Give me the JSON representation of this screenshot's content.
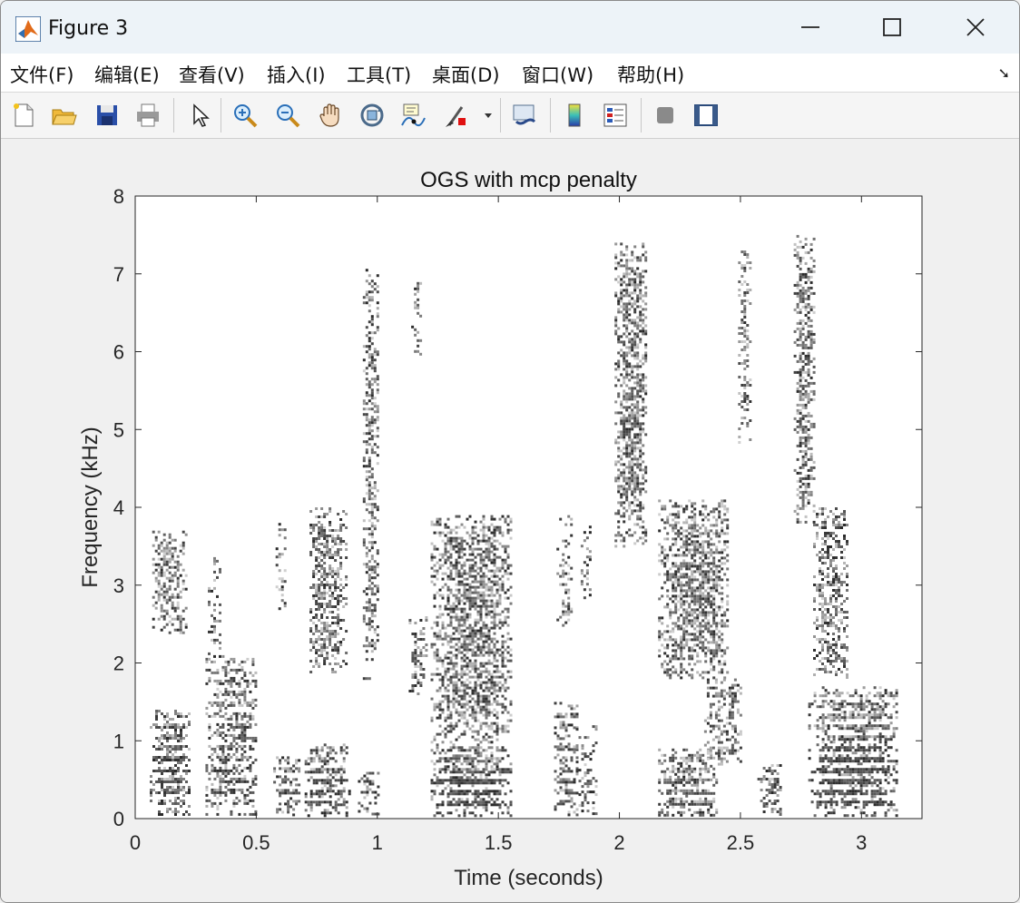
{
  "window": {
    "title": "Figure 3"
  },
  "menu": [
    "文件(F)",
    "编辑(E)",
    "查看(V)",
    "插入(I)",
    "工具(T)",
    "桌面(D)",
    "窗口(W)",
    "帮助(H)"
  ],
  "toolbar": [
    "new-figure-icon",
    "open-file-icon",
    "save-icon",
    "print-icon",
    "pointer-icon",
    "zoom-in-icon",
    "zoom-out-icon",
    "pan-icon",
    "rotate-3d-icon",
    "data-cursor-icon",
    "brush-icon",
    "link-plot-icon",
    "colorbar-icon",
    "legend-icon",
    "hide-plot-tools-icon",
    "show-plot-tools-icon"
  ],
  "chart_data": {
    "type": "heatmap",
    "title": "OGS with mcp penalty",
    "xlabel": "Time (seconds)",
    "ylabel": "Frequency (kHz)",
    "xlim": [
      0,
      3.25
    ],
    "ylim": [
      0,
      8
    ],
    "xticks": [
      "0",
      "0.5",
      "1",
      "1.5",
      "2",
      "2.5",
      "3"
    ],
    "yticks": [
      "0",
      "1",
      "2",
      "3",
      "4",
      "5",
      "6",
      "7",
      "8"
    ],
    "colormap": "gray-inverted",
    "grid": false,
    "blobs": [
      {
        "t": [
          0.06,
          0.22
        ],
        "f": [
          0.05,
          1.4
        ],
        "d": 0.85,
        "harmonics": true
      },
      {
        "t": [
          0.07,
          0.21
        ],
        "f": [
          2.4,
          3.7
        ],
        "d": 0.5
      },
      {
        "t": [
          0.29,
          0.5
        ],
        "f": [
          0.05,
          2.1
        ],
        "d": 0.75,
        "harmonics": true
      },
      {
        "t": [
          0.3,
          0.35
        ],
        "f": [
          2.0,
          3.5
        ],
        "d": 0.35
      },
      {
        "t": [
          0.57,
          0.68
        ],
        "f": [
          0.05,
          0.8
        ],
        "d": 0.7,
        "harmonics": true
      },
      {
        "t": [
          0.58,
          0.62
        ],
        "f": [
          2.7,
          3.8
        ],
        "d": 0.35
      },
      {
        "t": [
          0.7,
          0.88
        ],
        "f": [
          0.05,
          1.0
        ],
        "d": 0.8,
        "harmonics": true
      },
      {
        "t": [
          0.72,
          0.87
        ],
        "f": [
          1.9,
          4.0
        ],
        "d": 0.55
      },
      {
        "t": [
          0.92,
          1.0
        ],
        "f": [
          0.05,
          0.6
        ],
        "d": 0.75,
        "harmonics": true
      },
      {
        "t": [
          0.94,
          1.0
        ],
        "f": [
          1.8,
          7.1
        ],
        "d": 0.55
      },
      {
        "t": [
          1.14,
          1.18
        ],
        "f": [
          5.9,
          7.0
        ],
        "d": 0.3
      },
      {
        "t": [
          1.13,
          1.2
        ],
        "f": [
          1.6,
          2.6
        ],
        "d": 0.45
      },
      {
        "t": [
          1.22,
          1.55
        ],
        "f": [
          0.05,
          1.0
        ],
        "d": 0.85,
        "harmonics": true
      },
      {
        "t": [
          1.22,
          1.55
        ],
        "f": [
          1.0,
          3.9
        ],
        "d": 0.6
      },
      {
        "t": [
          1.73,
          1.82
        ],
        "f": [
          0.05,
          1.5
        ],
        "d": 0.75,
        "harmonics": true
      },
      {
        "t": [
          1.74,
          1.8
        ],
        "f": [
          2.4,
          3.9
        ],
        "d": 0.4
      },
      {
        "t": [
          1.82,
          1.9
        ],
        "f": [
          0.05,
          1.2
        ],
        "d": 0.65,
        "harmonics": true
      },
      {
        "t": [
          1.84,
          1.88
        ],
        "f": [
          2.8,
          3.8
        ],
        "d": 0.35
      },
      {
        "t": [
          1.98,
          2.11
        ],
        "f": [
          3.5,
          7.4
        ],
        "d": 0.65
      },
      {
        "t": [
          2.16,
          2.4
        ],
        "f": [
          0.05,
          0.9
        ],
        "d": 0.85,
        "harmonics": true
      },
      {
        "t": [
          2.16,
          2.45
        ],
        "f": [
          1.8,
          4.1
        ],
        "d": 0.6
      },
      {
        "t": [
          2.35,
          2.5
        ],
        "f": [
          0.7,
          1.8
        ],
        "d": 0.45
      },
      {
        "t": [
          2.49,
          2.54
        ],
        "f": [
          4.8,
          7.3
        ],
        "d": 0.45
      },
      {
        "t": [
          2.57,
          2.66
        ],
        "f": [
          0.05,
          0.7
        ],
        "d": 0.75,
        "harmonics": true
      },
      {
        "t": [
          2.72,
          2.8
        ],
        "f": [
          3.8,
          7.5
        ],
        "d": 0.6
      },
      {
        "t": [
          2.78,
          3.15
        ],
        "f": [
          0.05,
          1.7
        ],
        "d": 0.85,
        "harmonics": true
      },
      {
        "t": [
          2.8,
          2.94
        ],
        "f": [
          1.8,
          4.0
        ],
        "d": 0.5
      }
    ]
  }
}
